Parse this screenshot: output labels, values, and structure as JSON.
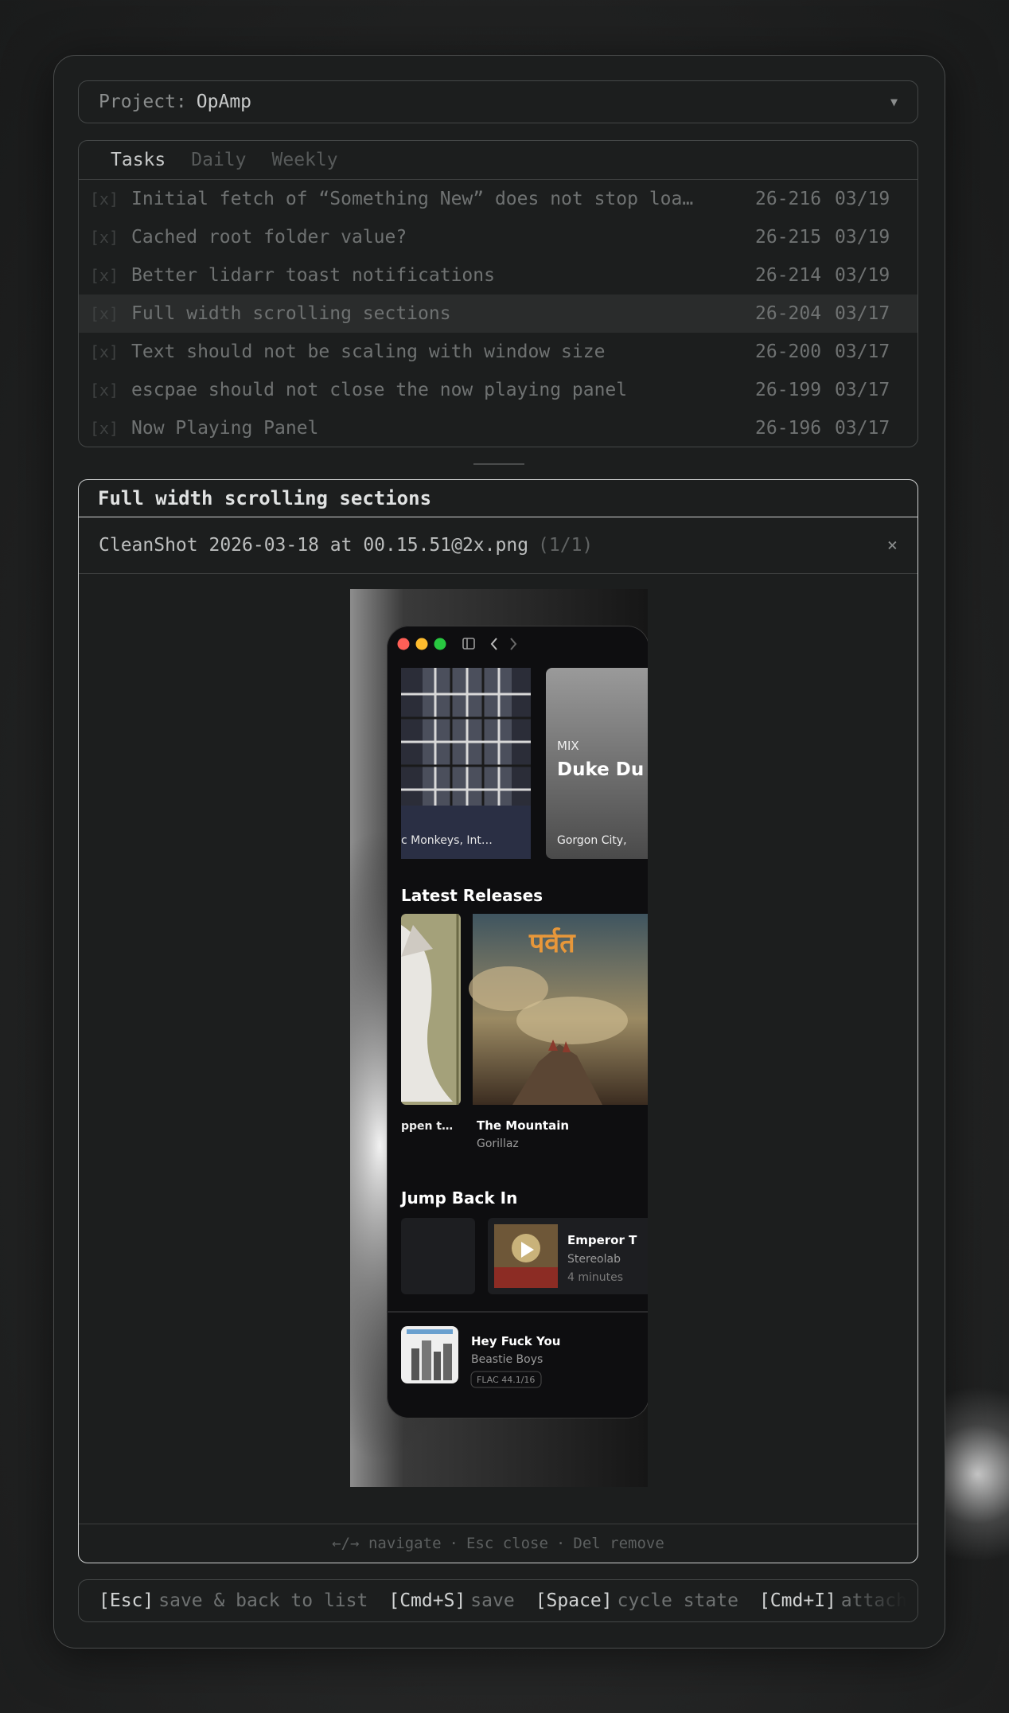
{
  "project": {
    "label": "Project:",
    "value": "OpAmp"
  },
  "tabs": [
    {
      "label": "Tasks"
    },
    {
      "label": "Daily"
    },
    {
      "label": "Weekly"
    }
  ],
  "tasks": [
    {
      "check": "[x]",
      "title": "Initial fetch of “Something New” does not stop loa…",
      "id": "26-216",
      "date": "03/19"
    },
    {
      "check": "[x]",
      "title": "Cached root folder value?",
      "id": "26-215",
      "date": "03/19"
    },
    {
      "check": "[x]",
      "title": "Better lidarr toast notifications",
      "id": "26-214",
      "date": "03/19"
    },
    {
      "check": "[x]",
      "title": "Full width scrolling sections",
      "id": "26-204",
      "date": "03/17"
    },
    {
      "check": "[x]",
      "title": "Text should not be scaling with window size",
      "id": "26-200",
      "date": "03/17"
    },
    {
      "check": "[x]",
      "title": "escpae should not close the now playing panel",
      "id": "26-199",
      "date": "03/17"
    },
    {
      "check": "[x]",
      "title": "Now Playing Panel",
      "id": "26-196",
      "date": "03/17"
    }
  ],
  "detail": {
    "title": "Full width scrolling sections",
    "attachment_name": "CleanShot 2026-03-18 at 00.15.51@2x.png",
    "attachment_count": "(1/1)",
    "close": "×"
  },
  "preview": {
    "mix_label": "MIX",
    "mix_title": "Duke Du",
    "mix_artists": "Gorgon City,",
    "tile_artists": "c Monkeys, Int…",
    "latest_heading": "Latest Releases",
    "release_1_title": "ppen t…",
    "release_2_title": "The Mountain",
    "release_2_artist": "Gorillaz",
    "album_art_text": "पर्वत",
    "jump_heading": "Jump Back In",
    "jump_title": "Emperor T",
    "jump_artist": "Stereolab",
    "jump_time": "4 minutes",
    "np_title": "Hey Fuck You",
    "np_artist": "Beastie Boys",
    "np_badge": "FLAC 44.1/16"
  },
  "hint": {
    "navigate": "←/→ navigate",
    "close": "Esc close",
    "remove": "Del remove",
    "sep": "·"
  },
  "shortcuts": [
    {
      "key": "[Esc]",
      "desc": "save & back to list"
    },
    {
      "key": "[Cmd+S]",
      "desc": "save"
    },
    {
      "key": "[Space]",
      "desc": "cycle state"
    },
    {
      "key": "[Cmd+I]",
      "desc": "attach"
    }
  ],
  "colors": {
    "selected_row": "#2a2c2c",
    "accent_border": "#cfd1d1",
    "traffic_red": "#ff5f57",
    "traffic_yellow": "#febc2e",
    "traffic_green": "#28c840"
  }
}
